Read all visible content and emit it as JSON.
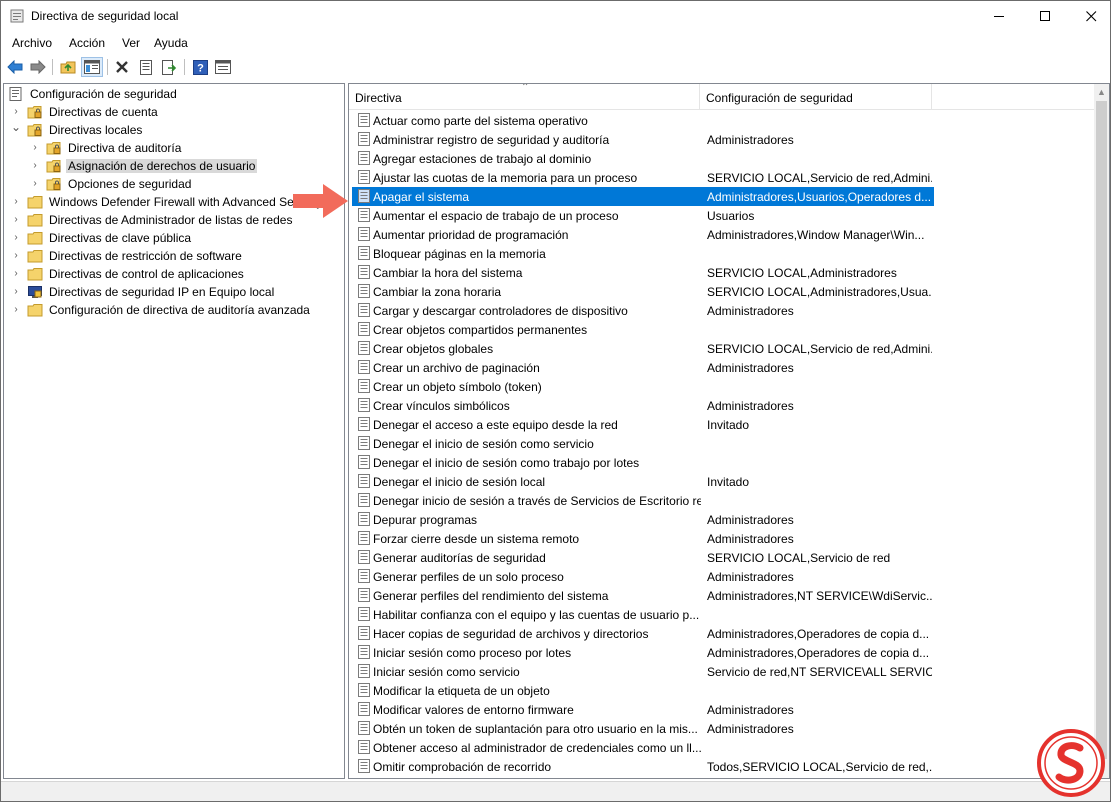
{
  "window": {
    "title": "Directiva de seguridad local"
  },
  "menu": [
    "Archivo",
    "Acción",
    "Ver",
    "Ayuda"
  ],
  "toolbar_icons": [
    "back-icon",
    "forward-icon",
    "up-folder-icon",
    "show-hide-tree-icon",
    "delete-icon",
    "properties-icon",
    "export-icon",
    "help-icon",
    "console-icon"
  ],
  "tree": [
    {
      "label": "Configuración de seguridad",
      "level": 0,
      "expander": "",
      "icon": "security-root-icon"
    },
    {
      "label": "Directivas de cuenta",
      "level": 1,
      "expander": "›",
      "icon": "folder-lock-icon"
    },
    {
      "label": "Directivas locales",
      "level": 1,
      "expander": "⌄",
      "icon": "folder-lock-icon"
    },
    {
      "label": "Directiva de auditoría",
      "level": 2,
      "expander": "›",
      "icon": "folder-lock-icon"
    },
    {
      "label": "Asignación de derechos de usuario",
      "level": 2,
      "expander": "›",
      "icon": "folder-lock-icon",
      "selected": true
    },
    {
      "label": "Opciones de seguridad",
      "level": 2,
      "expander": "›",
      "icon": "folder-lock-icon"
    },
    {
      "label": "Windows Defender Firewall with Advanced Security",
      "level": 1,
      "expander": "›",
      "icon": "folder-icon"
    },
    {
      "label": "Directivas de Administrador de listas de redes",
      "level": 1,
      "expander": "",
      "icon": "folder-icon"
    },
    {
      "label": "Directivas de clave pública",
      "level": 1,
      "expander": "›",
      "icon": "folder-icon"
    },
    {
      "label": "Directivas de restricción de software",
      "level": 1,
      "expander": "›",
      "icon": "folder-icon"
    },
    {
      "label": "Directivas de control de aplicaciones",
      "level": 1,
      "expander": "›",
      "icon": "folder-icon"
    },
    {
      "label": "Directivas de seguridad IP en Equipo local",
      "level": 1,
      "expander": "›",
      "icon": "ipsec-icon"
    },
    {
      "label": "Configuración de directiva de auditoría avanzada",
      "level": 1,
      "expander": "›",
      "icon": "folder-icon"
    }
  ],
  "list": {
    "columns": [
      "Directiva",
      "Configuración de seguridad"
    ],
    "rows": [
      {
        "policy": "Actuar como parte del sistema operativo",
        "setting": ""
      },
      {
        "policy": "Administrar registro de seguridad y auditoría",
        "setting": "Administradores"
      },
      {
        "policy": "Agregar estaciones de trabajo al dominio",
        "setting": ""
      },
      {
        "policy": "Ajustar las cuotas de la memoria para un proceso",
        "setting": "SERVICIO LOCAL,Servicio de red,Admini..."
      },
      {
        "policy": "Apagar el sistema",
        "setting": "Administradores,Usuarios,Operadores d...",
        "selected": true
      },
      {
        "policy": "Aumentar el espacio de trabajo de un proceso",
        "setting": "Usuarios"
      },
      {
        "policy": "Aumentar prioridad de programación",
        "setting": "Administradores,Window Manager\\Win..."
      },
      {
        "policy": "Bloquear páginas en la memoria",
        "setting": ""
      },
      {
        "policy": "Cambiar la hora del sistema",
        "setting": "SERVICIO LOCAL,Administradores"
      },
      {
        "policy": "Cambiar la zona horaria",
        "setting": "SERVICIO LOCAL,Administradores,Usua..."
      },
      {
        "policy": "Cargar y descargar controladores de dispositivo",
        "setting": "Administradores"
      },
      {
        "policy": "Crear objetos compartidos permanentes",
        "setting": ""
      },
      {
        "policy": "Crear objetos globales",
        "setting": "SERVICIO LOCAL,Servicio de red,Admini..."
      },
      {
        "policy": "Crear un archivo de paginación",
        "setting": "Administradores"
      },
      {
        "policy": "Crear un objeto símbolo (token)",
        "setting": ""
      },
      {
        "policy": "Crear vínculos simbólicos",
        "setting": "Administradores"
      },
      {
        "policy": "Denegar el acceso a este equipo desde la red",
        "setting": "Invitado"
      },
      {
        "policy": "Denegar el inicio de sesión como servicio",
        "setting": ""
      },
      {
        "policy": "Denegar el inicio de sesión como trabajo por lotes",
        "setting": ""
      },
      {
        "policy": "Denegar el inicio de sesión local",
        "setting": "Invitado"
      },
      {
        "policy": "Denegar inicio de sesión a través de Servicios de Escritorio re...",
        "setting": ""
      },
      {
        "policy": "Depurar programas",
        "setting": "Administradores"
      },
      {
        "policy": "Forzar cierre desde un sistema remoto",
        "setting": "Administradores"
      },
      {
        "policy": "Generar auditorías de seguridad",
        "setting": "SERVICIO LOCAL,Servicio de red"
      },
      {
        "policy": "Generar perfiles de un solo proceso",
        "setting": "Administradores"
      },
      {
        "policy": "Generar perfiles del rendimiento del sistema",
        "setting": "Administradores,NT SERVICE\\WdiServic..."
      },
      {
        "policy": "Habilitar confianza con el equipo y las cuentas de usuario p...",
        "setting": ""
      },
      {
        "policy": "Hacer copias de seguridad de archivos y directorios",
        "setting": "Administradores,Operadores de copia d..."
      },
      {
        "policy": "Iniciar sesión como proceso por lotes",
        "setting": "Administradores,Operadores de copia d..."
      },
      {
        "policy": "Iniciar sesión como servicio",
        "setting": "Servicio de red,NT SERVICE\\ALL SERVICES"
      },
      {
        "policy": "Modificar la etiqueta de un objeto",
        "setting": ""
      },
      {
        "policy": "Modificar valores de entorno firmware",
        "setting": "Administradores"
      },
      {
        "policy": "Obtén un token de suplantación para otro usuario en la mis...",
        "setting": "Administradores"
      },
      {
        "policy": "Obtener acceso al administrador de credenciales como un ll...",
        "setting": ""
      },
      {
        "policy": "Omitir comprobación de recorrido",
        "setting": "Todos,SERVICIO LOCAL,Servicio de red,..."
      }
    ]
  },
  "colors": {
    "selection": "#0078d7",
    "tree_selection": "#d9d9d9",
    "arrow": "#f26b5b",
    "logo": "#e5322d"
  }
}
